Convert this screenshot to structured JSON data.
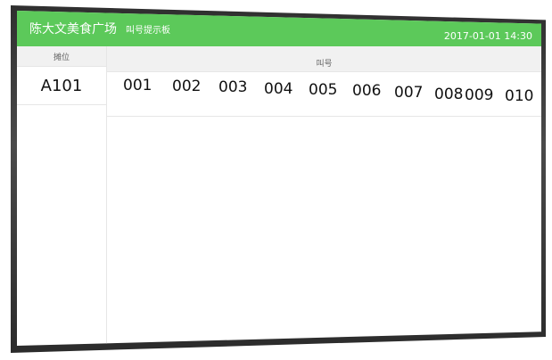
{
  "header": {
    "brand": "陈大文美食广场",
    "board_title": "叫号提示板",
    "datetime": "2017-01-01 14:30"
  },
  "table": {
    "stall_header": "摊位",
    "call_header": "叫号",
    "stall": "A101",
    "numbers": [
      "001",
      "002",
      "003",
      "004",
      "005",
      "006",
      "007",
      "008",
      "009",
      "010"
    ]
  },
  "colors": {
    "header_bg": "#5cc95a",
    "header_text": "#ffffff",
    "bezel": "#333333"
  }
}
